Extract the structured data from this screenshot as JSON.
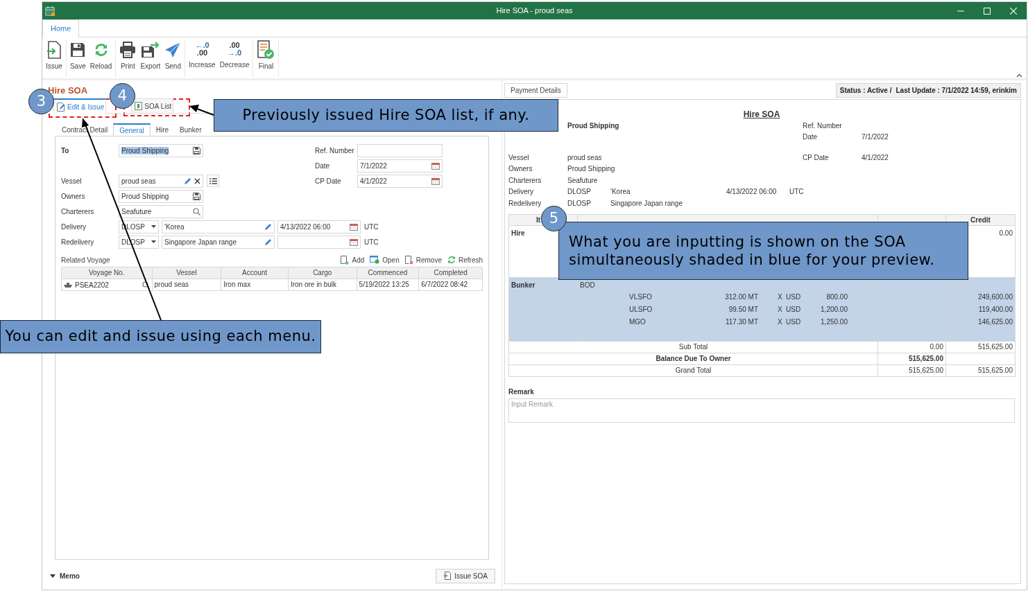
{
  "window": {
    "title": "Hire SOA - proud seas"
  },
  "ribbon": {
    "tabs": [
      {
        "label": "Home",
        "selected": true
      }
    ],
    "groups": [
      {
        "buttons": [
          {
            "kind": "issue",
            "label": "Issue"
          }
        ]
      },
      {
        "buttons": [
          {
            "kind": "save",
            "label": "Save"
          },
          {
            "kind": "reload",
            "label": "Reload"
          }
        ]
      },
      {
        "buttons": [
          {
            "kind": "print",
            "label": "Print"
          },
          {
            "kind": "export",
            "label": "Export"
          },
          {
            "kind": "send",
            "label": "Send"
          }
        ]
      },
      {
        "buttons": [
          {
            "kind": "increase",
            "label": "Increase",
            "glyph": [
              "←.0",
              ".00"
            ]
          },
          {
            "kind": "decrease",
            "label": "Decrease",
            "glyph": [
              ".00",
              "→.0"
            ]
          }
        ]
      },
      {
        "buttons": [
          {
            "kind": "final",
            "label": "Final"
          }
        ]
      }
    ]
  },
  "editor": {
    "title": "Hire SOA",
    "modes": [
      {
        "label": "Edit & Issue",
        "selected": true
      },
      {
        "label": "SOA List",
        "selected": false
      }
    ],
    "tabs": [
      {
        "label": "Contract Detail",
        "selected": false
      },
      {
        "label": "General",
        "selected": true
      },
      {
        "label": "Hire",
        "selected": false
      },
      {
        "label": "Bunker",
        "selected": false
      }
    ],
    "form": {
      "rows": [
        {
          "left": {
            "kind": "recipient",
            "label": "To",
            "value": "Proud Shipping",
            "text_selected": true
          },
          "right": {
            "kind": "text",
            "label": "Ref. Number"
          }
        },
        {
          "right": {
            "kind": "date",
            "label": "Date",
            "value": "7/1/2022"
          }
        },
        {
          "left": {
            "kind": "vessel",
            "label": "Vessel",
            "value": "proud seas"
          },
          "right": {
            "kind": "date",
            "label": "CP Date",
            "value": "4/1/2022"
          }
        },
        {
          "left": {
            "kind": "lookup",
            "label": "Owners",
            "value": "Proud Shipping",
            "text_selected": false
          }
        },
        {
          "left": {
            "kind": "search",
            "label": "Charterers",
            "value": "Seafuture"
          }
        },
        {
          "left": {
            "kind": "port",
            "label": "Delivery",
            "code": "DLOSP",
            "place": "'Korea",
            "datetime": "4/13/2022 06:00",
            "tz": "UTC"
          }
        },
        {
          "left": {
            "kind": "port",
            "label": "Redelivery",
            "code": "DLOSP",
            "place": "Singapore Japan range",
            "tz": "UTC"
          }
        }
      ]
    },
    "related_voyage": {
      "title": "Related Voyage",
      "actions": [
        {
          "kind": "add",
          "label": "Add"
        },
        {
          "kind": "open",
          "label": "Open"
        },
        {
          "kind": "remove",
          "label": "Remove"
        },
        {
          "kind": "refresh",
          "label": "Refresh"
        }
      ],
      "columns": [
        "Voyage No.",
        "Vessel",
        "Account",
        "Cargo",
        "Commenced",
        "Completed"
      ],
      "rows": [
        [
          "PSEA2202",
          "proud seas",
          "Iron max",
          "Iron ore in bulk",
          "5/19/2022 13:25",
          "6/7/2022 08:42"
        ]
      ]
    },
    "memo": "Memo",
    "issue_button": "Issue SOA"
  },
  "preview_panel": {
    "payment_details": "Payment Details",
    "status": "Status : Active /",
    "last_update": "Last Update : 7/1/2022 14:59, erinkim",
    "soa": {
      "title": "Hire SOA",
      "to": "Proud Shipping",
      "meta": [
        {
          "label": "Ref. Number"
        },
        {
          "label": "Date",
          "value": "7/1/2022"
        }
      ],
      "details": [
        {
          "label": "Vessel",
          "values": [
            "proud seas"
          ],
          "right": {
            "label": "CP Date",
            "value": "4/1/2022"
          }
        },
        {
          "label": "Owners",
          "values": [
            "Proud Shipping"
          ]
        },
        {
          "label": "Charterers",
          "values": [
            "Seafuture"
          ]
        },
        {
          "label": "Delivery",
          "values": [
            "DLOSP",
            "'Korea",
            "4/13/2022 06:00",
            "UTC"
          ]
        },
        {
          "label": "Redelivery",
          "values": [
            "DLOSP",
            "Singapore Japan range"
          ]
        }
      ],
      "table": {
        "header": {
          "item": "It",
          "credit": "Credit"
        },
        "items": [
          {
            "item": "Hire",
            "highlighted": false,
            "credit": "0.00"
          },
          {
            "item": "Bunker",
            "highlighted": true,
            "description": "BOD",
            "lines": [
              {
                "fuel": "VLSFO",
                "qty": "312.00 MT",
                "op": "X",
                "currency": "USD",
                "price": "800.00",
                "credit": "249,600.00"
              },
              {
                "fuel": "ULSFO",
                "qty": "99.50 MT",
                "op": "X",
                "currency": "USD",
                "price": "1,200.00",
                "credit": "119,400.00"
              },
              {
                "fuel": "MGO",
                "qty": "117.30 MT",
                "op": "X",
                "currency": "USD",
                "price": "1,250.00",
                "credit": "146,625.00"
              }
            ]
          }
        ],
        "totals": [
          {
            "label": "Sub Total",
            "bold": false,
            "debit": "0.00",
            "credit": "515,625.00"
          },
          {
            "label": "Balance Due To Owner",
            "bold": true,
            "debit": "515,625.00"
          },
          {
            "label": "Grand Total",
            "bold": false,
            "debit": "515,625.00",
            "credit": "515,625.00"
          }
        ]
      },
      "remark": {
        "label": "Remark",
        "placeholder": "Input Remark"
      }
    }
  },
  "annotations": {
    "badges": [
      "3",
      "4",
      "5"
    ],
    "callouts": [
      "Previously issued Hire SOA list, if any.",
      "What you are inputting is shown on the SOA simultaneously shaded in blue for your preview.",
      "You can edit and issue using each menu."
    ]
  }
}
